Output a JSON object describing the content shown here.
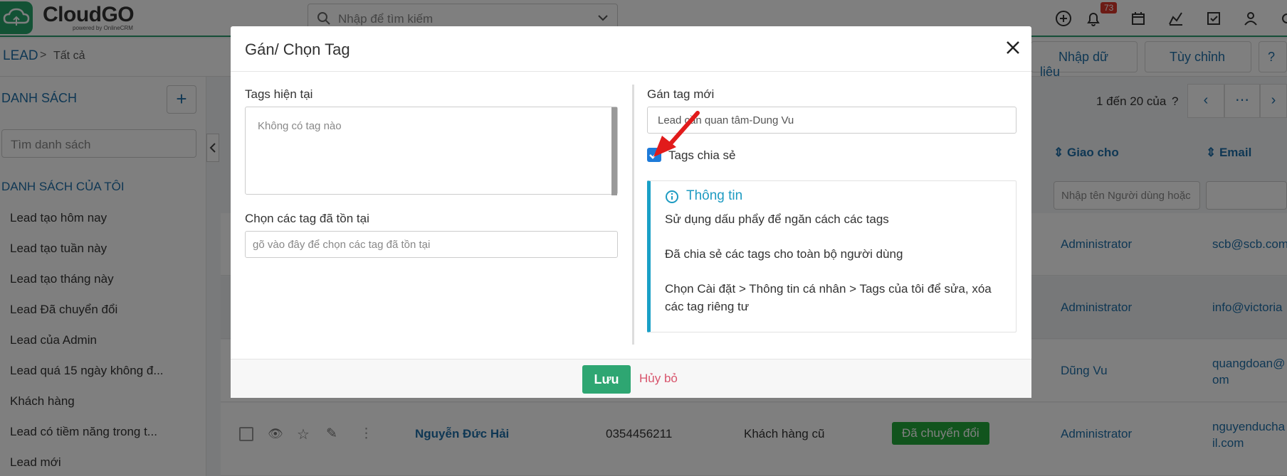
{
  "app": {
    "logo_text": "CloudGO",
    "logo_sub": "powered by OnlineCRM",
    "search_placeholder": "Nhập để tìm kiếm",
    "notification_count": "73"
  },
  "breadcrumb": {
    "module": "LEAD",
    "separator": ">",
    "current": "Tất cả"
  },
  "header_buttons": {
    "import": "Nhập dữ liệu",
    "customize": "Tùy chỉnh"
  },
  "sidebar": {
    "list_heading": "DANH SÁCH",
    "search_placeholder": "Tìm danh sách",
    "my_lists_heading": "DANH SÁCH CỦA TÔI",
    "items": [
      "Lead tạo hôm nay",
      "Lead tạo tuần này",
      "Lead tạo tháng này",
      "Lead Đã chuyển đổi",
      "Lead của Admin",
      "Lead quá 15 ngày không đ...",
      "Khách hàng",
      "Lead có tiềm năng trong t...",
      "Lead mới"
    ]
  },
  "list": {
    "pager_text": "1 đến 20 của",
    "pager_help": "?",
    "col_assigned": "Giao cho",
    "col_email": "Email",
    "filter_assigned_placeholder": "Nhập tên Người dùng hoặc",
    "rows": [
      {
        "assigned": "Administrator",
        "email": "scb@scb.com"
      },
      {
        "assigned": "Administrator",
        "email": "info@victoria"
      },
      {
        "assigned": "Dũng Vu",
        "email": "quangdoan@\nom"
      },
      {
        "name": "Nguyễn Đức Hải",
        "phone": "0354456211",
        "type": "Khách hàng cũ",
        "status": "Đã chuyển đổi",
        "assigned": "Administrator",
        "email": "nguyenducha\nil.com"
      }
    ]
  },
  "modal": {
    "title": "Gán/ Chọn Tag",
    "current_tags_label": "Tags hiện tại",
    "current_tags_empty": "Không có tag nào",
    "existing_tags_label": "Chọn các tag đã tồn tại",
    "existing_tags_placeholder": "gõ vào đây để chọn các tag đã tồn tại",
    "new_tag_label": "Gán tag mới",
    "new_tag_value": "Lead cần quan tâm-Dung Vu",
    "shared_checkbox_label": "Tags chia sẻ",
    "shared_checked": true,
    "info_title": "Thông tin",
    "info_lines": [
      "Sử dụng dấu phẩy để ngăn cách các tags",
      "Đã chia sẻ các tags cho toàn bộ người dùng",
      "Chọn Cài đặt > Thông tin cá nhân > Tags của tôi để sửa, xóa các tag riêng tư"
    ],
    "save_label": "Lưu",
    "cancel_label": "Hủy bỏ"
  },
  "colors": {
    "brand_green": "#27a56b",
    "link_blue": "#1e6fa8",
    "info_accent": "#1aa0c7",
    "cancel_red": "#d8546c",
    "status_green": "#22a83a",
    "annotation_arrow": "#e11b1b"
  }
}
